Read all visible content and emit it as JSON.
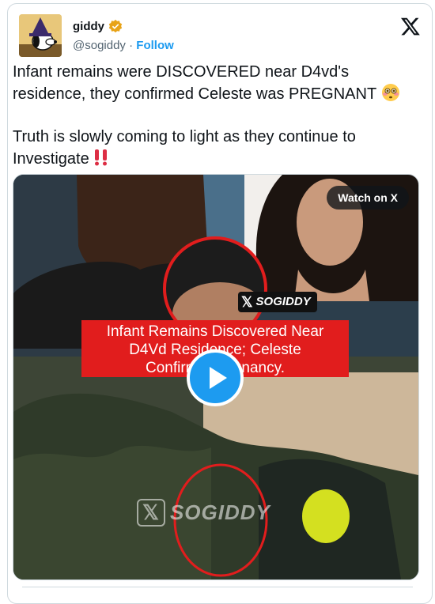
{
  "author": {
    "name": "giddy",
    "handle": "@sogiddy",
    "separator": "·",
    "follow_label": "Follow"
  },
  "tweet": {
    "line1": "Infant remains were DISCOVERED near D4vd's residence, they confirmed Celeste was PREGNANT",
    "line2": "Truth is slowly coming to light as they continue to Investigate"
  },
  "media": {
    "watch_label": "Watch on X",
    "banner_line1": "Infant Remains Discovered Near",
    "banner_line2": "D4Vd Residence; Celeste",
    "banner_line3": "Confirms Pregnancy.",
    "badge_text": "SOGIDDY",
    "watermark_text": "SOGIDDY"
  },
  "colors": {
    "accent": "#1d9bf0",
    "banner": "#e11d1d",
    "verified": "#e8a317"
  },
  "icons": [
    "x-logo-icon",
    "verified-badge-icon",
    "flushed-face-emoji",
    "double-exclamation-emoji",
    "play-icon"
  ]
}
